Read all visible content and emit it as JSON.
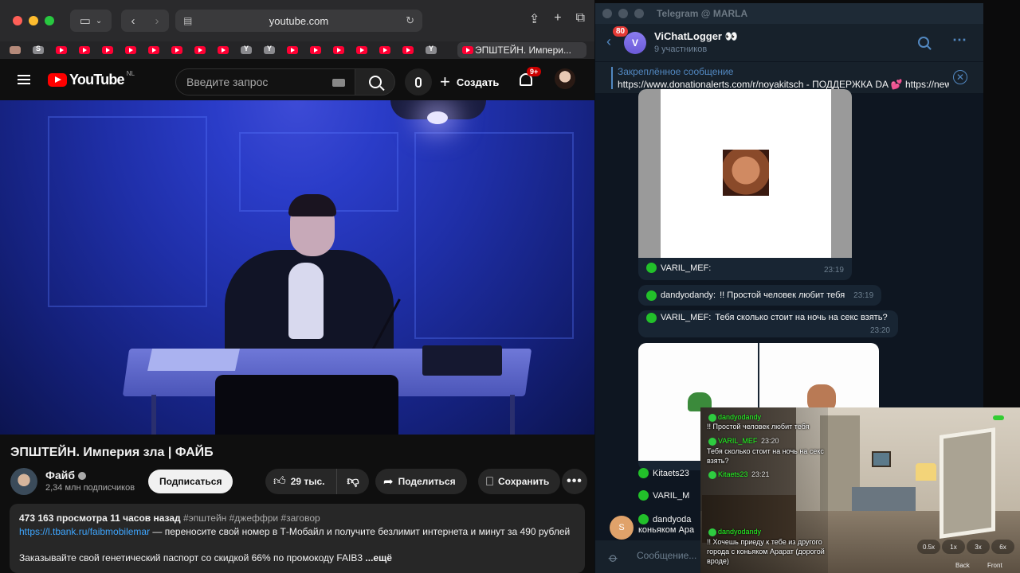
{
  "safari": {
    "url": "youtube.com",
    "active_tab_label": "ЭПШТЕЙН. Импери...",
    "bookmark_letters": [
      "S",
      "Y",
      "Y",
      "Y"
    ]
  },
  "youtube": {
    "region": "NL",
    "logo_text": "YouTube",
    "search_placeholder": "Введите запрос",
    "create_label": "Создать",
    "notifications_badge": "9+",
    "video_title": "ЭПШТЕЙН. Империя зла | ФАЙБ",
    "channel_name": "Файб",
    "subscribers": "2,34 млн подписчиков",
    "subscribe_label": "Подписаться",
    "likes": "29 тыс.",
    "share_label": "Поделиться",
    "save_label": "Сохранить",
    "description": {
      "views": "473 163 просмотра",
      "age": "11 часов назад",
      "tags": "#эпштейн #джеффри #заговор",
      "link": "https://l.tbank.ru/faibmobilemar",
      "line1_rest": " — переносите свой номер в Т-Мобайл и получите безлимит интернета и минут за 490 рублей",
      "line3": "Заказывайте свой генетический паспорт со скидкой 66% по промокоду FAIB3",
      "more": "...ещё"
    }
  },
  "telegram": {
    "window_title": "Telegram @ MARLA",
    "unread_count": "80",
    "chat_avatar_letter": "V",
    "chat_name": "ViChatLogger 👀",
    "members": "9 участников",
    "pinned_title": "Закреплённое сообщение",
    "pinned_text": "https://www.donationalerts.com/r/noyakitsch - ПОДДЕРЖКА DA 💕 https://new...",
    "messages": [
      {
        "sender": "VARIL_MEF:",
        "text": "",
        "time": "23:19"
      },
      {
        "sender": "dandyodandy:",
        "text": "!! Простой человек любит тебя",
        "time": "23:19"
      },
      {
        "sender": "VARIL_MEF:",
        "text": "Тебя сколько стоит на ночь на секс взять?",
        "time": "23:20"
      }
    ],
    "list_senders": [
      "Kitaets23",
      "VARIL_M",
      "dandyoda"
    ],
    "last_preview": "коньяком Ара",
    "avatar_letter": "S",
    "compose_placeholder": "Сообщение..."
  },
  "stream": {
    "overlay_lines": [
      {
        "user": "dandyodandy",
        "text": "!! Простой человек любит тебя"
      },
      {
        "user": "VARIL_MEF",
        "text": "Тебя сколько стоит на ночь на секс взять?"
      },
      {
        "user": "Kitaets23",
        "text": ""
      },
      {
        "user": "dandyodandy",
        "text": "!! Хочешь приеду к тебе из другого города с коньяком Арарат (дорогой вроде)"
      }
    ],
    "time_a": "23:20",
    "time_b": "23:21",
    "speeds": [
      "0.5x",
      "1x",
      "3x",
      "6x"
    ],
    "back_label": "Back",
    "front_label": "Front"
  }
}
